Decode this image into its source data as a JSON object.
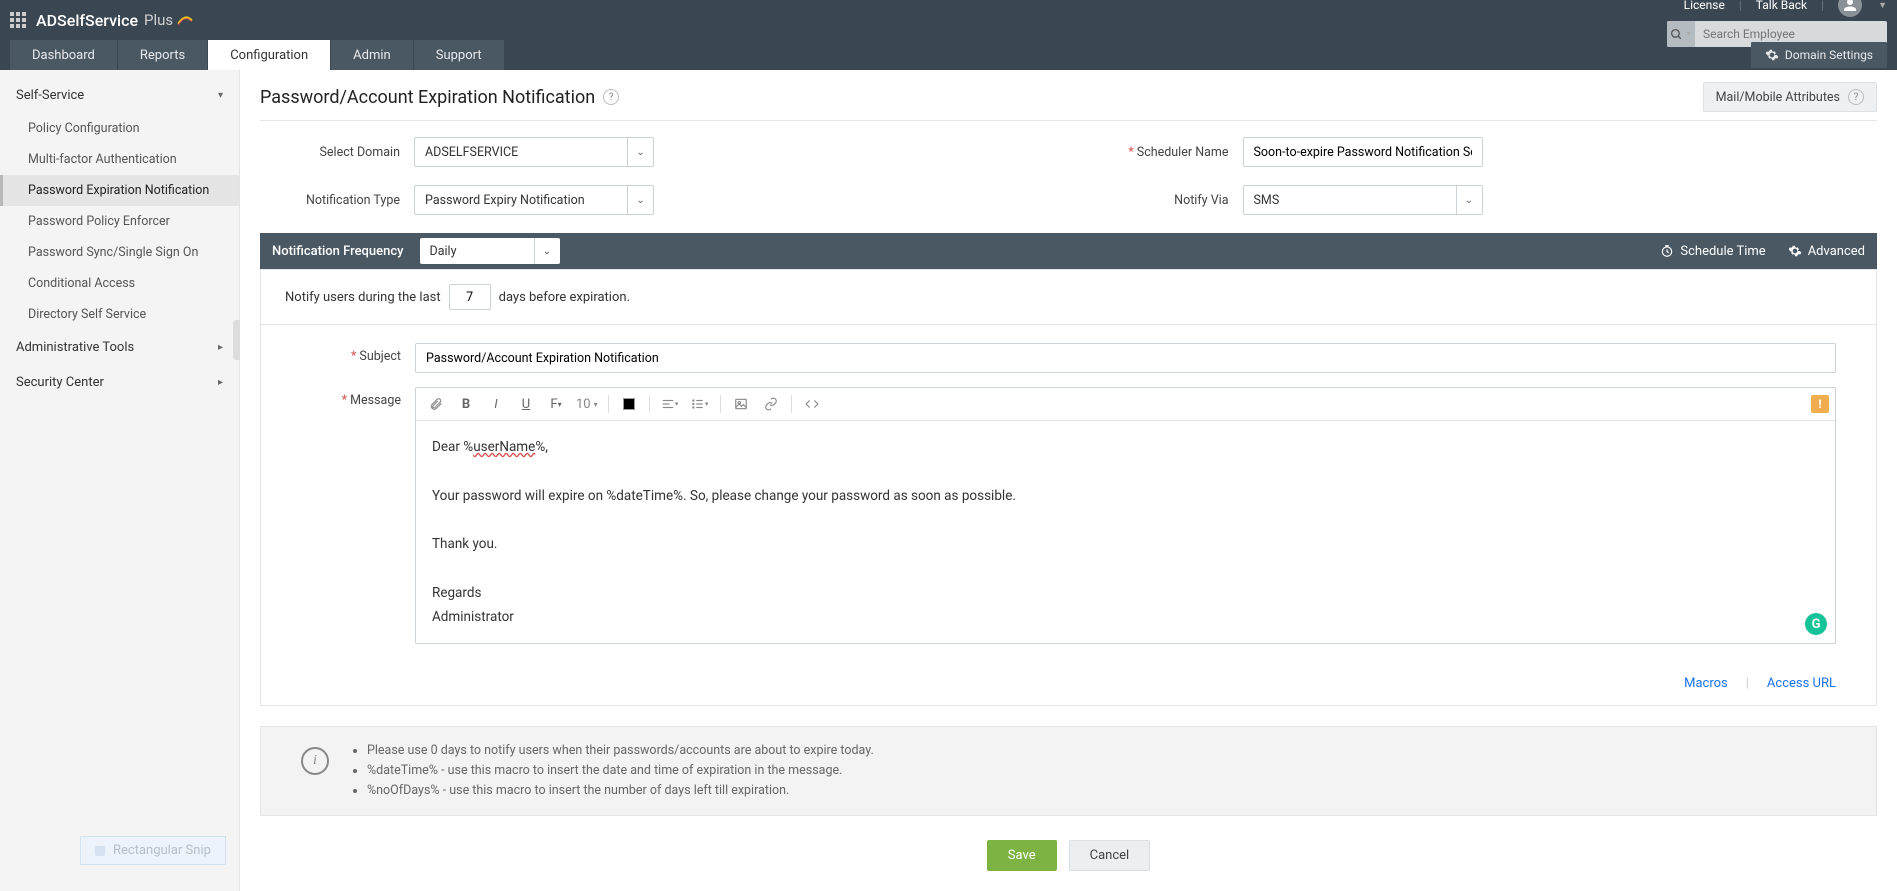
{
  "header": {
    "brand_main": "ADSelfService",
    "brand_suffix": "Plus",
    "license": "License",
    "talkback": "Talk Back",
    "search_placeholder": "Search Employee"
  },
  "tabs": {
    "dashboard": "Dashboard",
    "reports": "Reports",
    "configuration": "Configuration",
    "admin": "Admin",
    "support": "Support",
    "domain_settings": "Domain Settings"
  },
  "sidebar": {
    "self_service": "Self-Service",
    "items": [
      "Policy Configuration",
      "Multi-factor Authentication",
      "Password Expiration Notification",
      "Password Policy Enforcer",
      "Password Sync/Single Sign On",
      "Conditional Access",
      "Directory Self Service"
    ],
    "admin_tools": "Administrative Tools",
    "security_center": "Security Center"
  },
  "page": {
    "title": "Password/Account Expiration Notification",
    "attribs_btn": "Mail/Mobile Attributes"
  },
  "form": {
    "select_domain_label": "Select Domain",
    "select_domain_value": "ADSELFSERVICE",
    "scheduler_name_label": "Scheduler Name",
    "scheduler_name_value": "Soon-to-expire Password Notification Scl",
    "notification_type_label": "Notification Type",
    "notification_type_value": "Password Expiry Notification",
    "notify_via_label": "Notify Via",
    "notify_via_value": "SMS"
  },
  "frequency": {
    "label": "Notification Frequency",
    "value": "Daily",
    "schedule_time": "Schedule Time",
    "advanced": "Advanced"
  },
  "notify": {
    "prefix": "Notify users during the last",
    "days_value": "7",
    "suffix": "days before expiration."
  },
  "compose": {
    "subject_label": "Subject",
    "subject_value": "Password/Account Expiration Notification",
    "message_label": "Message",
    "font_size": "10",
    "body_greeting_prefix": "Dear %",
    "body_greeting_macro": "userName",
    "body_greeting_suffix": "%,",
    "body_line2": "Your password will expire on %dateTime%. So, please change your password as soon as possible.",
    "body_line3": "Thank you.",
    "body_line4": "Regards",
    "body_line5": "Administrator",
    "macros_link": "Macros",
    "access_url_link": "Access URL"
  },
  "info": {
    "line1": "Please use 0 days to notify users when their passwords/accounts are about to expire today.",
    "line2": "%dateTime% - use this macro to insert the date and time of expiration in the message.",
    "line3": "%noOfDays% - use this macro to insert the number of days left till expiration."
  },
  "buttons": {
    "save": "Save",
    "cancel": "Cancel"
  },
  "snip": "Rectangular Snip"
}
